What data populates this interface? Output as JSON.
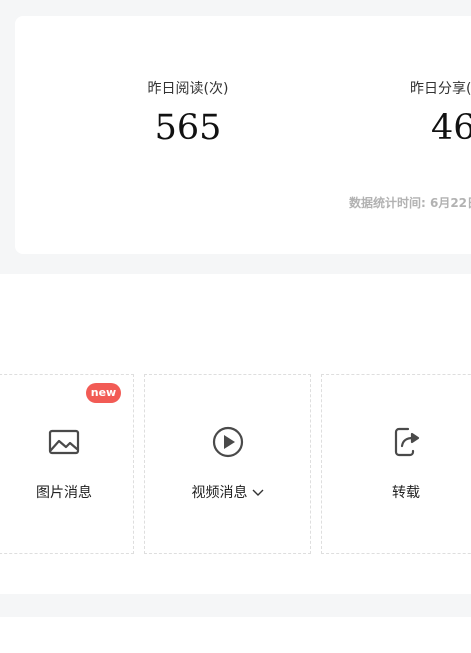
{
  "stats": {
    "read_label": "昨日阅读(次)",
    "read_value": "565",
    "share_label": "昨日分享(",
    "share_value": "46",
    "time_label": "数据统计时间: 6月22日"
  },
  "tools": {
    "image": {
      "label": "图片消息",
      "icon": "image-icon",
      "badge": "new"
    },
    "video": {
      "label": "视频消息",
      "icon": "play-circle-icon",
      "dropdown_icon": "chevron-down-icon"
    },
    "repost": {
      "label": "转载",
      "icon": "share-arrow-icon"
    }
  },
  "colors": {
    "background": "#f5f6f7",
    "card": "#ffffff",
    "badge": "#f25b55",
    "muted_text": "#b2b2b2",
    "icon": "#4a4a4a"
  }
}
